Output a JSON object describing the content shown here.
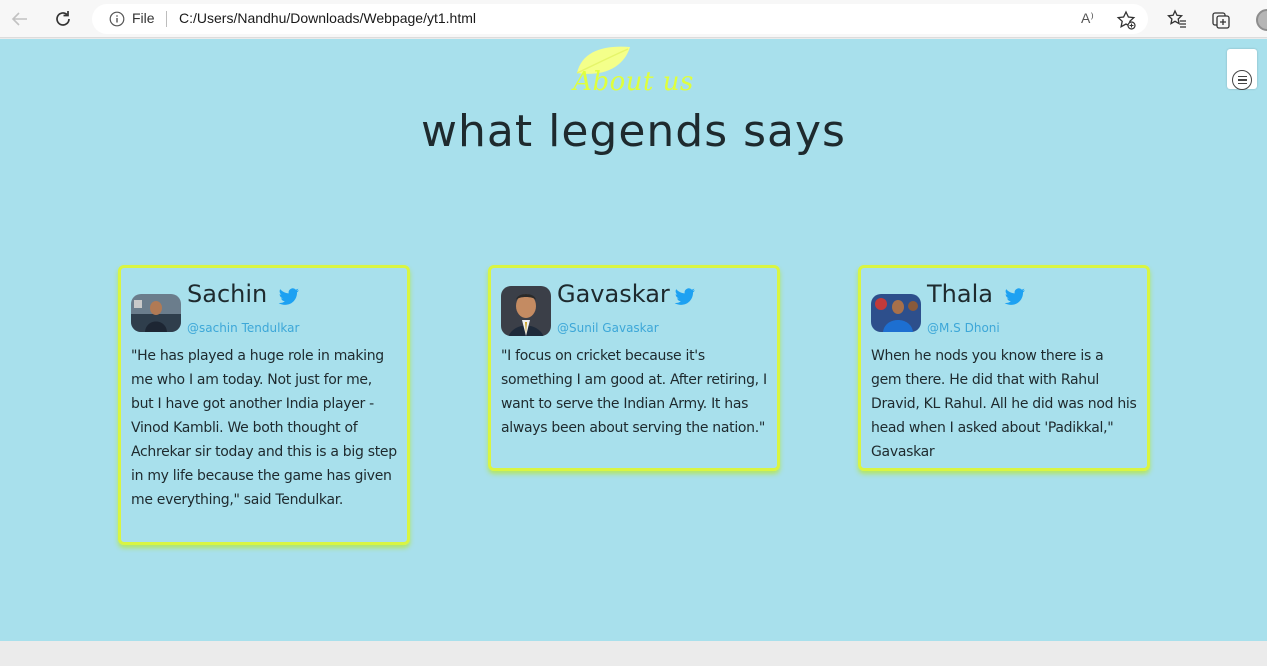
{
  "browser": {
    "file_label": "File",
    "url": "C:/Users/Nandhu/Downloads/Webpage/yt1.html",
    "read_aloud_label": "A⁾"
  },
  "header": {
    "about": "About us",
    "title": "what legends says"
  },
  "colors": {
    "background": "#a8e0ec",
    "accent": "#dfff3c",
    "card_border": "#d9f542",
    "handle": "#3da7d8",
    "twitter": "#1da1f2"
  },
  "cards": [
    {
      "name": "Sachin",
      "handle": "@sachin Tendulkar",
      "quote": "\"He has played a huge role in making me who I am today. Not just for me, but I have got another India player - Vinod Kambli. We both thought of Achrekar sir today and this is a big step in my life because the game has given me everything,\" said Tendulkar.",
      "icon": "twitter-icon"
    },
    {
      "name": "Gavaskar",
      "handle": "@Sunil Gavaskar",
      "quote": "\"I focus on cricket because it's something I am good at. After retiring, I want to serve the Indian Army. It has always been about serving the nation.\"",
      "icon": "twitter-icon"
    },
    {
      "name": "Thala",
      "handle": "@M.S Dhoni",
      "quote": "When he nods you know there is a gem there. He did that with Rahul Dravid, KL Rahul. All he did was nod his head when I asked about 'Padikkal,\" Gavaskar",
      "icon": "twitter-icon"
    }
  ]
}
